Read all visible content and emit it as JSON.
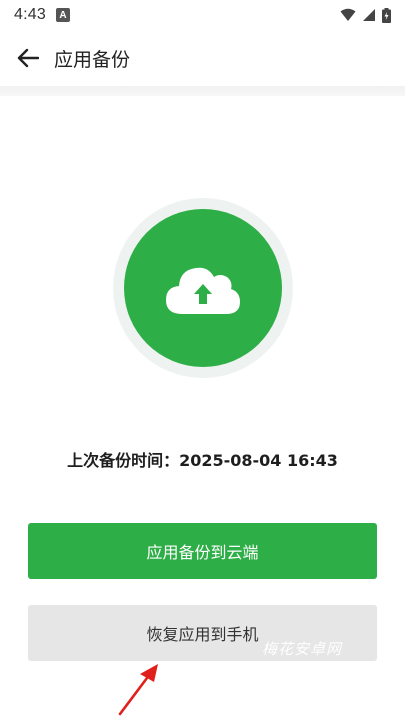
{
  "status_bar": {
    "time": "4:43",
    "notification_letter": "A"
  },
  "app_bar": {
    "title": "应用备份"
  },
  "backup": {
    "last_backup_label": "上次备份时间：",
    "last_backup_time": "2025-08-04 16:43",
    "backup_to_cloud_label": "应用备份到云端",
    "restore_to_phone_label": "恢复应用到手机"
  },
  "watermark": "梅花安卓网",
  "icons": [
    "back-arrow-icon",
    "cloud-upload-icon",
    "wifi-icon",
    "signal-icon",
    "battery-icon"
  ],
  "colors": {
    "accent": "#2eae46",
    "secondary_button": "#e6e6e6",
    "annotation_arrow": "#e0201c"
  }
}
